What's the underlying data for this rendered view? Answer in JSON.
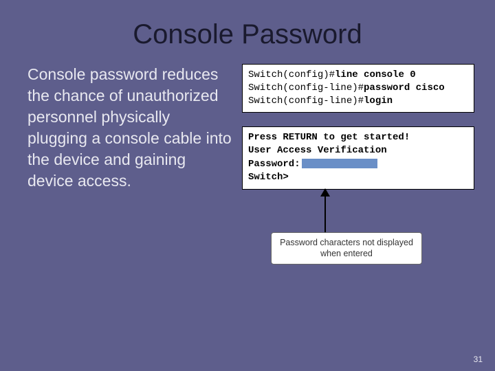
{
  "title": "Console Password",
  "body_text": "Console password reduces the chance of unauthorized personnel physically plugging a console cable into the device and gaining device access.",
  "terminal1": {
    "l1_prefix": "Switch(config)#",
    "l1_cmd": "line console 0",
    "l2_prefix": "Switch(config-line)#",
    "l2_cmd": "password cisco",
    "l3_prefix": "Switch(config-line)#",
    "l3_cmd": "login"
  },
  "terminal2": {
    "l1": "Press RETURN to get started!",
    "l2": "User Access Verification",
    "l3": "Password:",
    "l4": "Switch>"
  },
  "callout": "Password characters not displayed when entered",
  "page_number": "31"
}
